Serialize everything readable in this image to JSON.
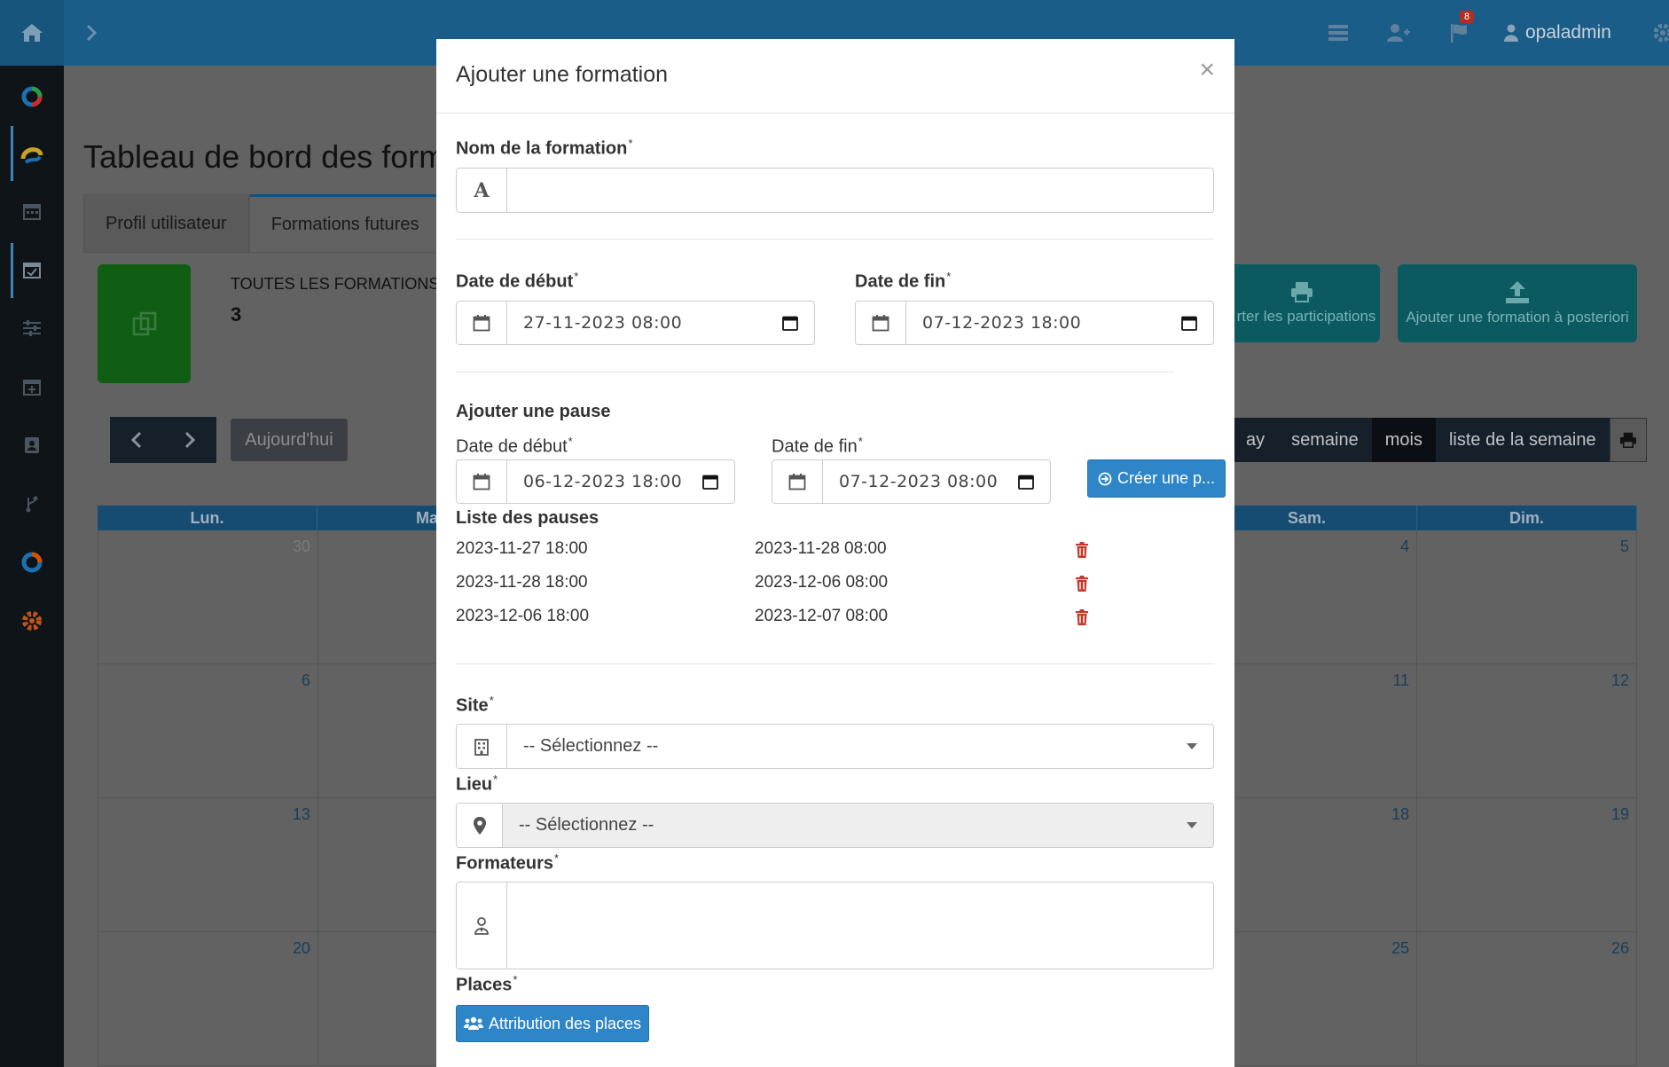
{
  "topbar": {
    "badge_count": "8",
    "username": "opaladmin"
  },
  "background": {
    "page_title": "Tableau de bord des forma",
    "tabs": [
      "Profil utilisateur",
      "Formations futures"
    ],
    "stat_label": "TOUTES LES FORMATIONS",
    "stat_value": "3",
    "action_print_label": "rter les participations",
    "action_upload_label": "Ajouter une formation à posteriori",
    "today_label": "Aujourd'hui",
    "views": [
      "ay",
      "semaine",
      "mois",
      "liste de la semaine"
    ],
    "weekdays": [
      "Lun.",
      "Ma",
      "",
      "",
      "",
      "Sam.",
      "Dim."
    ],
    "weeks": [
      [
        "30",
        "",
        "",
        "",
        "",
        "4",
        "5"
      ],
      [
        "6",
        "",
        "",
        "",
        "",
        "11",
        "12"
      ],
      [
        "13",
        "",
        "",
        "",
        "",
        "18",
        "19"
      ],
      [
        "20",
        "",
        "",
        "",
        "",
        "25",
        "26"
      ]
    ]
  },
  "modal": {
    "title": "Ajouter une formation",
    "close": "×",
    "name_label": "Nom de la formation",
    "name_value": "",
    "start_label": "Date de début",
    "start_value": "27-11-2023 08:00",
    "end_label": "Date de fin",
    "end_value": "07-12-2023 18:00",
    "pause_section_label": "Ajouter une pause",
    "pause_start_label": "Date de début",
    "pause_start_value": "06-12-2023 18:00",
    "pause_end_label": "Date de fin",
    "pause_end_value": "07-12-2023 08:00",
    "create_pause_label": "Créer une p...",
    "pauses_list_label": "Liste des pauses",
    "pauses": [
      {
        "start": "2023-11-27 18:00",
        "end": "2023-11-28 08:00"
      },
      {
        "start": "2023-11-28 18:00",
        "end": "2023-12-06 08:00"
      },
      {
        "start": "2023-12-06 18:00",
        "end": "2023-12-07 08:00"
      }
    ],
    "site_label": "Site",
    "site_value": "-- Sélectionnez --",
    "lieu_label": "Lieu",
    "lieu_value": "-- Sélectionnez --",
    "trainers_label": "Formateurs",
    "places_label": "Places",
    "places_button": "Attribution des places",
    "required_mark": "*",
    "text_icon_glyph": "A"
  },
  "colors": {
    "topbar": "#1a5d88",
    "sidebar": "#0f1418",
    "primary_button": "#2e86c8",
    "delete_icon": "#c0392b"
  }
}
